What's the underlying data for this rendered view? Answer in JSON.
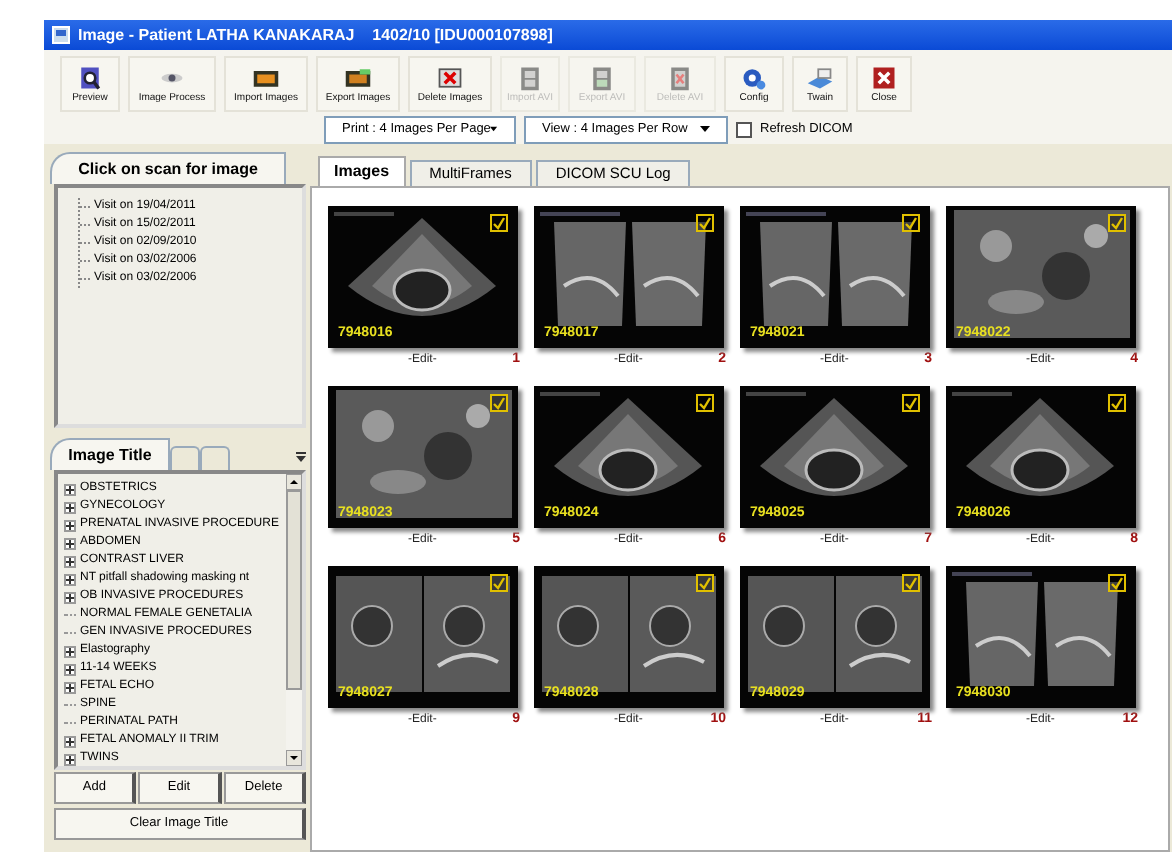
{
  "window": {
    "title": "Image - Patient LATHA KANAKARAJ    1402/10 [IDU000107898]"
  },
  "toolbar": [
    {
      "label": "Preview",
      "disabled": false
    },
    {
      "label": "Image Process",
      "disabled": false
    },
    {
      "label": "Import Images",
      "disabled": false
    },
    {
      "label": "Export Images",
      "disabled": false
    },
    {
      "label": "Delete Images",
      "disabled": false
    },
    {
      "label": "Import AVI",
      "disabled": true
    },
    {
      "label": "Export AVI",
      "disabled": true
    },
    {
      "label": "Delete AVI",
      "disabled": true
    },
    {
      "label": "Config",
      "disabled": false
    },
    {
      "label": "Twain",
      "disabled": false
    },
    {
      "label": "Close",
      "disabled": false
    }
  ],
  "print_dropdown": "Print : 4 Images Per Page",
  "view_dropdown": "View : 4 Images Per Row",
  "refresh_dicom": {
    "label": "Refresh DICOM",
    "checked": false
  },
  "visits_panel": {
    "title": "Click on scan for image",
    "items": [
      "Visit on 19/04/2011",
      "Visit on 15/02/2011",
      "Visit on 02/09/2010",
      "Visit on 03/02/2006",
      "Visit on 03/02/2006"
    ]
  },
  "image_title_panel": {
    "title": "Image Title",
    "items": [
      {
        "label": "OBSTETRICS",
        "expandable": true
      },
      {
        "label": "GYNECOLOGY",
        "expandable": true
      },
      {
        "label": "PRENATAL INVASIVE PROCEDURE",
        "expandable": true
      },
      {
        "label": "ABDOMEN",
        "expandable": true
      },
      {
        "label": "CONTRAST LIVER",
        "expandable": true
      },
      {
        "label": "NT pitfall shadowing masking nt",
        "expandable": true
      },
      {
        "label": "OB INVASIVE PROCEDURES",
        "expandable": true
      },
      {
        "label": "NORMAL FEMALE GENETALIA",
        "expandable": false
      },
      {
        "label": "GEN INVASIVE PROCEDURES",
        "expandable": false
      },
      {
        "label": "Elastography",
        "expandable": true
      },
      {
        "label": "11-14 WEEKS",
        "expandable": true
      },
      {
        "label": "FETAL ECHO",
        "expandable": true
      },
      {
        "label": "SPINE",
        "expandable": false
      },
      {
        "label": "PERINATAL PATH",
        "expandable": false
      },
      {
        "label": "FETAL ANOMALY II TRIM",
        "expandable": true
      },
      {
        "label": "TWINS",
        "expandable": true
      }
    ],
    "buttons": [
      "Add",
      "Edit",
      "Delete"
    ],
    "clear_button": "Clear Image Title"
  },
  "tabs": [
    {
      "label": "Images",
      "selected": true
    },
    {
      "label": "MultiFrames",
      "selected": false
    },
    {
      "label": "DICOM SCU Log",
      "selected": false
    }
  ],
  "images": [
    {
      "id": "7948016",
      "caption": "-Edit-",
      "number": "1",
      "checked": true
    },
    {
      "id": "7948017",
      "caption": "-Edit-",
      "number": "2",
      "checked": true
    },
    {
      "id": "7948021",
      "caption": "-Edit-",
      "number": "3",
      "checked": true
    },
    {
      "id": "7948022",
      "caption": "-Edit-",
      "number": "4",
      "checked": true
    },
    {
      "id": "7948023",
      "caption": "-Edit-",
      "number": "5",
      "checked": true
    },
    {
      "id": "7948024",
      "caption": "-Edit-",
      "number": "6",
      "checked": true
    },
    {
      "id": "7948025",
      "caption": "-Edit-",
      "number": "7",
      "checked": true
    },
    {
      "id": "7948026",
      "caption": "-Edit-",
      "number": "8",
      "checked": true
    },
    {
      "id": "7948027",
      "caption": "-Edit-",
      "number": "9",
      "checked": true
    },
    {
      "id": "7948028",
      "caption": "-Edit-",
      "number": "10",
      "checked": true
    },
    {
      "id": "7948029",
      "caption": "-Edit-",
      "number": "11",
      "checked": true
    },
    {
      "id": "7948030",
      "caption": "-Edit-",
      "number": "12",
      "checked": true
    }
  ]
}
